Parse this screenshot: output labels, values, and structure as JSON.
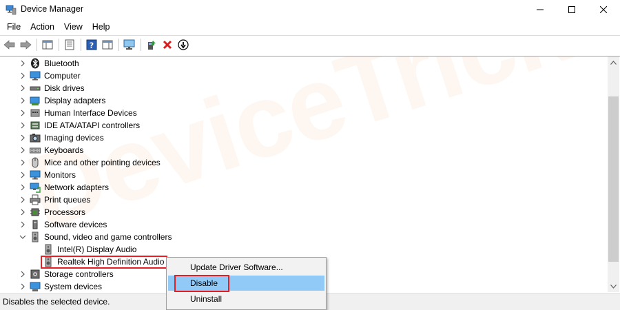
{
  "window": {
    "title": "Device Manager",
    "icon": "device-manager-icon"
  },
  "menu": {
    "items": [
      {
        "label": "File"
      },
      {
        "label": "Action"
      },
      {
        "label": "View"
      },
      {
        "label": "Help"
      }
    ]
  },
  "toolbar": {
    "buttons": [
      {
        "icon": "back-arrow-icon"
      },
      {
        "icon": "forward-arrow-icon"
      },
      {
        "icon": "show-hide-console-tree-icon"
      },
      {
        "icon": "properties-icon"
      },
      {
        "icon": "help-icon"
      },
      {
        "icon": "show-action-pane-icon"
      },
      {
        "icon": "scan-hardware-icon"
      },
      {
        "icon": "update-driver-icon"
      },
      {
        "icon": "uninstall-icon"
      },
      {
        "icon": "disable-device-icon"
      }
    ]
  },
  "tree": {
    "nodes": [
      {
        "label": "Bluetooth",
        "icon": "bluetooth-icon",
        "expanded": false,
        "level": 0
      },
      {
        "label": "Computer",
        "icon": "computer-icon",
        "expanded": false,
        "level": 0
      },
      {
        "label": "Disk drives",
        "icon": "disk-drive-icon",
        "expanded": false,
        "level": 0
      },
      {
        "label": "Display adapters",
        "icon": "display-adapter-icon",
        "expanded": false,
        "level": 0
      },
      {
        "label": "Human Interface Devices",
        "icon": "hid-icon",
        "expanded": false,
        "level": 0
      },
      {
        "label": "IDE ATA/ATAPI controllers",
        "icon": "ide-controller-icon",
        "expanded": false,
        "level": 0
      },
      {
        "label": "Imaging devices",
        "icon": "camera-icon",
        "expanded": false,
        "level": 0
      },
      {
        "label": "Keyboards",
        "icon": "keyboard-icon",
        "expanded": false,
        "level": 0
      },
      {
        "label": "Mice and other pointing devices",
        "icon": "mouse-icon",
        "expanded": false,
        "level": 0
      },
      {
        "label": "Monitors",
        "icon": "monitor-icon",
        "expanded": false,
        "level": 0
      },
      {
        "label": "Network adapters",
        "icon": "network-adapter-icon",
        "expanded": false,
        "level": 0
      },
      {
        "label": "Print queues",
        "icon": "printer-icon",
        "expanded": false,
        "level": 0
      },
      {
        "label": "Processors",
        "icon": "processor-icon",
        "expanded": false,
        "level": 0
      },
      {
        "label": "Software devices",
        "icon": "software-device-icon",
        "expanded": false,
        "level": 0
      },
      {
        "label": "Sound, video and game controllers",
        "icon": "speaker-icon",
        "expanded": true,
        "level": 0
      },
      {
        "label": "Intel(R) Display Audio",
        "icon": "speaker-icon",
        "level": 1
      },
      {
        "label": "Realtek High Definition Audio",
        "icon": "speaker-icon",
        "level": 1,
        "selected": true
      },
      {
        "label": "Storage controllers",
        "icon": "storage-controller-icon",
        "expanded": false,
        "level": 0
      },
      {
        "label": "System devices",
        "icon": "system-device-icon",
        "expanded": false,
        "level": 0
      }
    ]
  },
  "context_menu": {
    "items": [
      {
        "label": "Update Driver Software..."
      },
      {
        "label": "Disable",
        "hover": true
      },
      {
        "label": "Uninstall"
      }
    ]
  },
  "status": {
    "text": "Disables the selected device."
  },
  "watermark": {
    "text": "DeviceTricks"
  },
  "colors": {
    "highlight_red": "#e31e24",
    "menu_hover": "#91c9f7",
    "status_bg": "#f0f0f0"
  }
}
